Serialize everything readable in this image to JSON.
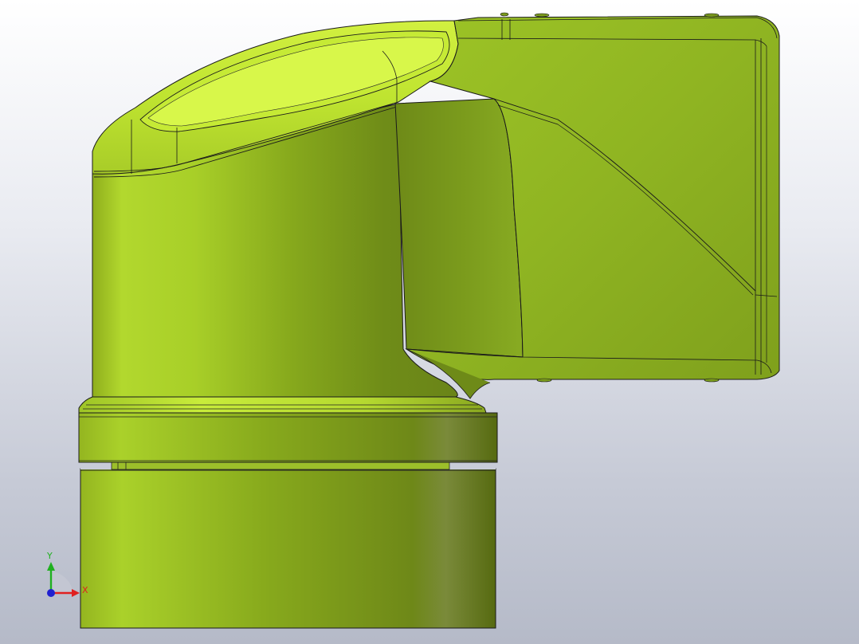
{
  "viewport": {
    "model_color": "#b5dc2c",
    "edge_color": "#1a1a1a"
  },
  "triad": {
    "x_label": "X",
    "y_label": "Y",
    "x_color": "#e02020",
    "y_color": "#20b020",
    "z_color": "#2020d0"
  }
}
